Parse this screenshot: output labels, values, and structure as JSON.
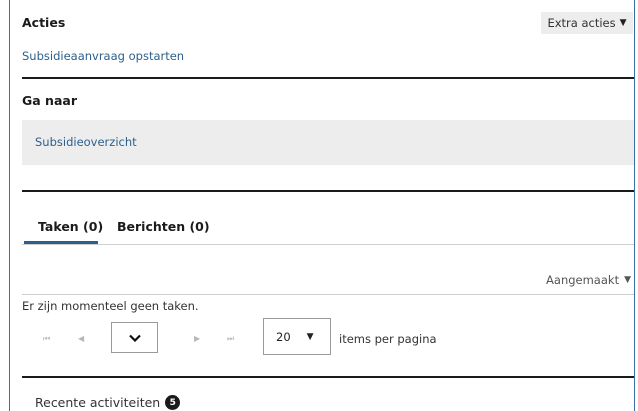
{
  "actions": {
    "title": "Acties",
    "extra_label": "Extra acties",
    "start_link": "Subsidieaanvraag opstarten"
  },
  "goto": {
    "title": "Ga naar",
    "overview_link": "Subsidieoverzicht"
  },
  "tabs": [
    {
      "label": "Taken (0)",
      "active": true
    },
    {
      "label": "Berichten (0)",
      "active": false
    }
  ],
  "sort": {
    "label": "Aangemaakt"
  },
  "tasks": {
    "empty_message": "Er zijn momenteel geen taken."
  },
  "pagination": {
    "first": "⏮",
    "prev": "◀",
    "next": "▶",
    "last": "⏭",
    "page_size": "20",
    "per_page_label": "items per pagina"
  },
  "recent": {
    "title": "Recente activiteiten",
    "count": "5"
  },
  "colors": {
    "link": "#2d5f8d",
    "frame": "#3a6ea5",
    "panel": "#ededed"
  }
}
